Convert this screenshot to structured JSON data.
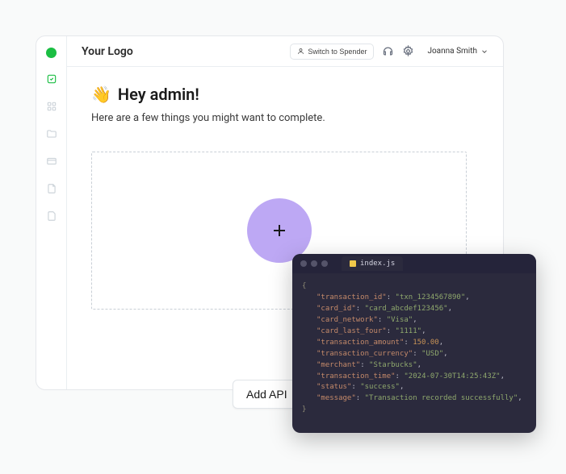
{
  "header": {
    "logo": "Your Logo",
    "switch_label": "Switch to Spender",
    "user_name": "Joanna Smith"
  },
  "greeting": {
    "emoji": "👋",
    "title": "Hey admin!",
    "subtitle": "Here are a few things you might want to complete."
  },
  "add_api_label": "Add API",
  "code_editor": {
    "filename": "index.js",
    "json": {
      "transaction_id": "txn_1234567890",
      "card_id": "card_abcdef123456",
      "card_network": "Visa",
      "card_last_four": "1111",
      "transaction_amount": 150.0,
      "transaction_currency": "USD",
      "merchant": "Starbucks",
      "transaction_time": "2024-07-30T14:25:43Z",
      "status": "success",
      "message": "Transaction recorded successfully"
    }
  }
}
